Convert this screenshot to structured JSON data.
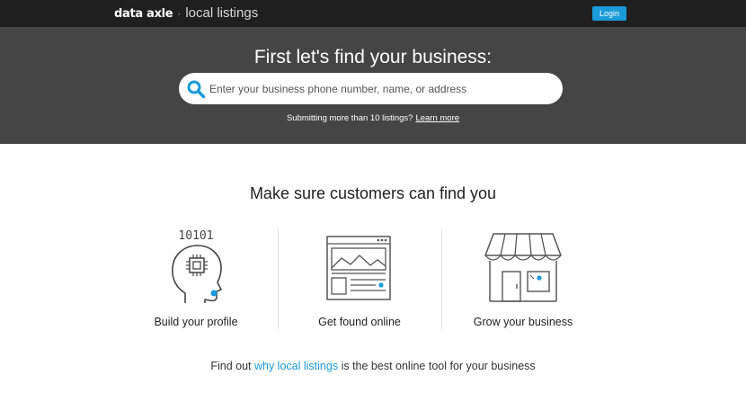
{
  "header": {
    "brand_name": "data axle",
    "brand_separator": "·",
    "brand_product": "local listings",
    "login_label": "Login"
  },
  "hero": {
    "title": "First let's find your business:",
    "search_placeholder": "Enter your business phone number, name, or address",
    "note_text": "Submitting more than 10 listings?",
    "note_link": "Learn more"
  },
  "section": {
    "title": "Make sure customers can find you",
    "features": [
      {
        "label": "Build your profile",
        "icon": "ai-head-chip-icon",
        "binary_text": "10101"
      },
      {
        "label": "Get found online",
        "icon": "browser-window-icon"
      },
      {
        "label": "Grow your business",
        "icon": "storefront-icon"
      }
    ]
  },
  "footer": {
    "prefix": "Find out",
    "link": "why local listings",
    "suffix": "is the best online tool for your business"
  },
  "colors": {
    "topbar": "#1f1f1f",
    "hero": "#454545",
    "accent": "#1a9ad9"
  }
}
